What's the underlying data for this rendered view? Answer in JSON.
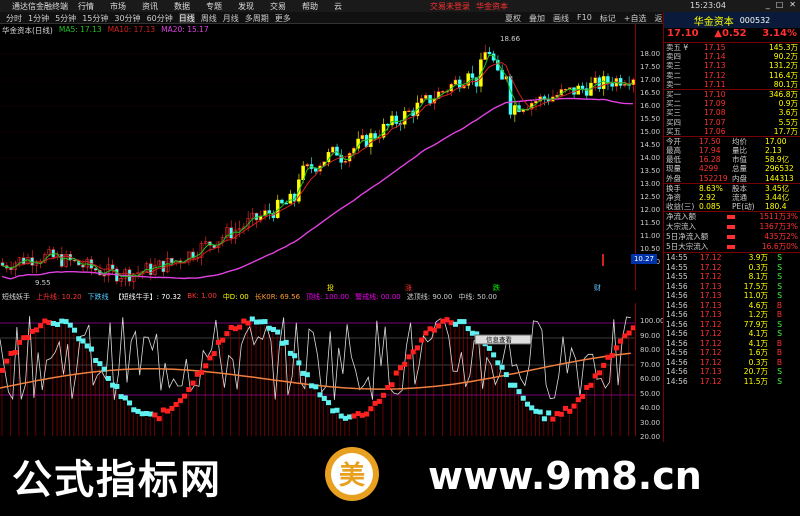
{
  "titlebar": {
    "app": "通达信金融终端",
    "menus": [
      "行情",
      "市场",
      "资讯",
      "数据",
      "专题",
      "发现",
      "交易",
      "帮助",
      "云"
    ],
    "notice": "交易未登录",
    "broker": "华金资本",
    "time": "15:23:04"
  },
  "toolbar": {
    "periods": [
      "分时",
      "1分钟",
      "5分钟",
      "15分钟",
      "30分钟",
      "60分钟",
      "日线",
      "周线",
      "月线",
      "多周期",
      "更多"
    ],
    "active_period": "日线",
    "right_buttons": [
      "夏权",
      "叠加",
      "画线",
      "F10",
      "标记",
      "+自选",
      "返回"
    ]
  },
  "chart": {
    "stock": "华金资本(日线)",
    "ma5": "MA5: 17.13",
    "ma10": "MA10: 17.13",
    "ma20": "MA20: 15.17",
    "high_label": "18.66",
    "low_label": "9.55",
    "price_ticks": [
      "18.00",
      "17.50",
      "17.00",
      "16.50",
      "16.00",
      "15.50",
      "15.00",
      "14.50",
      "14.00",
      "13.50",
      "13.00",
      "12.50",
      "12.00",
      "11.50",
      "11.00",
      "10.50",
      "10.00"
    ],
    "current_price_tag": "10.27",
    "signals": [
      "投",
      "涨",
      "跌",
      "财"
    ]
  },
  "indicator": {
    "name": "短线妖手",
    "fields": [
      "上升线: 10.20",
      "下跌线",
      "【短线牛手】: 70.32",
      "BK: 1.00",
      "中D: 00",
      "长K0R: 69.56",
      "顶线: 100.00",
      "警戒线: 00.00",
      "选顶线: 90.00",
      "中线: 50.00"
    ],
    "scale": [
      "100.00",
      "90.00",
      "80.00",
      "70.00",
      "60.00",
      "50.00",
      "40.00",
      "30.00",
      "20.00"
    ],
    "popup": "信息查看"
  },
  "rpanel": {
    "name": "华金资本",
    "code": "000532",
    "price": "17.10",
    "change": "▲0.52",
    "pct": "3.14%",
    "asks": [
      {
        "label": "卖五 ¥",
        "price": "17.15",
        "vol": "145.3万"
      },
      {
        "label": "卖四",
        "price": "17.14",
        "vol": "90.2万"
      },
      {
        "label": "卖三",
        "price": "17.13",
        "vol": "131.2万"
      },
      {
        "label": "卖二",
        "price": "17.12",
        "vol": "116.4万"
      },
      {
        "label": "卖一",
        "price": "17.11",
        "vol": "80.1万"
      }
    ],
    "bids": [
      {
        "label": "买一",
        "price": "17.10",
        "vol": "346.8万"
      },
      {
        "label": "买二",
        "price": "17.09",
        "vol": "0.9万"
      },
      {
        "label": "买三",
        "price": "17.08",
        "vol": "3.6万"
      },
      {
        "label": "买四",
        "price": "17.07",
        "vol": "5.5万"
      },
      {
        "label": "买五",
        "price": "17.06",
        "vol": "17.7万"
      }
    ],
    "stats": [
      [
        "今开",
        "17.50",
        "均价",
        "17.00"
      ],
      [
        "最高",
        "17.94",
        "量比",
        "2.13"
      ],
      [
        "最低",
        "16.28",
        "市值",
        "58.9亿"
      ],
      [
        "现量",
        "4299",
        "总量",
        "296532"
      ],
      [
        "外盘",
        "152219",
        "内盘",
        "144313"
      ]
    ],
    "stats2": [
      [
        "换手",
        "8.63%",
        "股本",
        "3.45亿"
      ],
      [
        "净资",
        "2.92",
        "流通",
        "3.44亿"
      ],
      [
        "收益(三)",
        "0.085",
        "PE(动)",
        "180.4"
      ]
    ],
    "flows": [
      {
        "label": "净流入额",
        "val": "1511万",
        "pct": "3%"
      },
      {
        "label": "大宗流入",
        "val": "1367万",
        "pct": "3%"
      },
      {
        "label": "5日净流入额",
        "val": "435万",
        "pct": "2%"
      },
      {
        "label": "5日大宗流入",
        "val": "16.6万",
        "pct": "0%"
      }
    ],
    "ticks": [
      [
        "14:55",
        "17.12",
        "3.9万",
        "S"
      ],
      [
        "14:55",
        "17.12",
        "0.3万",
        "S"
      ],
      [
        "14:55",
        "17.12",
        "8.1万",
        "S"
      ],
      [
        "14:56",
        "17.13",
        "17.5万",
        "S"
      ],
      [
        "14:56",
        "17.13",
        "11.0万",
        "S"
      ],
      [
        "14:56",
        "17.13",
        "4.6万",
        "B"
      ],
      [
        "14:56",
        "17.13",
        "1.2万",
        "B"
      ],
      [
        "14:56",
        "17.12",
        "77.9万",
        "S"
      ],
      [
        "14:56",
        "17.12",
        "4.1万",
        "S"
      ],
      [
        "14:56",
        "17.12",
        "4.1万",
        "B"
      ],
      [
        "14:56",
        "17.12",
        "1.6万",
        "B"
      ],
      [
        "14:56",
        "17.12",
        "0.3万",
        "B"
      ],
      [
        "14:56",
        "17.13",
        "20.7万",
        "S"
      ],
      [
        "14:56",
        "17.12",
        "11.5万",
        "S"
      ]
    ]
  },
  "watermark": {
    "left": "公式指标网",
    "right": "www.9m8.cn",
    "logo_text": "美"
  }
}
